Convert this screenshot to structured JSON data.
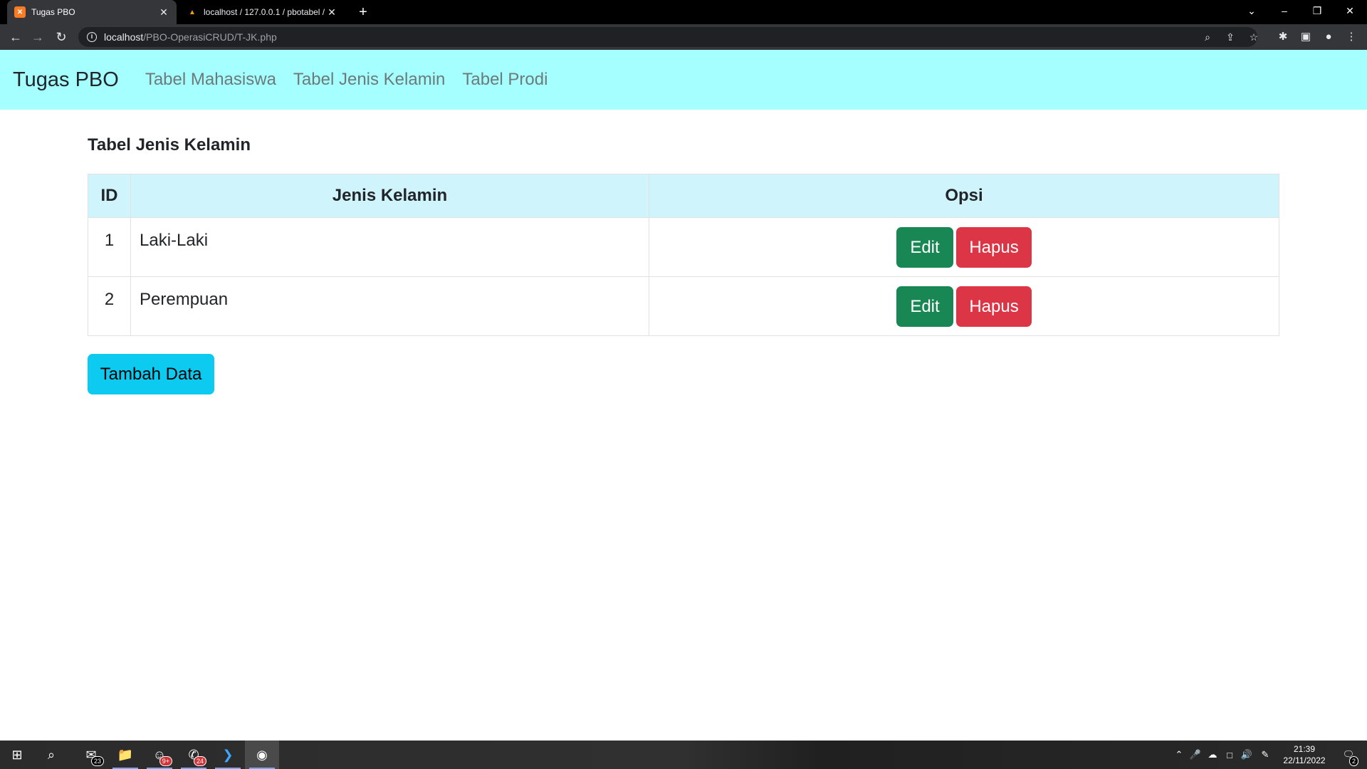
{
  "browser": {
    "tabs": [
      {
        "title": "Tugas PBO",
        "active": true
      },
      {
        "title": "localhost / 127.0.0.1 / pbotabel /",
        "active": false
      }
    ],
    "url_host": "localhost",
    "url_path": "/PBO-OperasiCRUD/T-JK.php"
  },
  "navbar": {
    "brand": "Tugas PBO",
    "links": [
      "Tabel Mahasiswa",
      "Tabel Jenis Kelamin",
      "Tabel Prodi"
    ]
  },
  "main": {
    "heading": "Tabel Jenis Kelamin",
    "columns": [
      "ID",
      "Jenis Kelamin",
      "Opsi"
    ],
    "rows": [
      {
        "id": "1",
        "jenis_kelamin": "Laki-Laki",
        "edit": "Edit",
        "hapus": "Hapus"
      },
      {
        "id": "2",
        "jenis_kelamin": "Perempuan",
        "edit": "Edit",
        "hapus": "Hapus"
      }
    ],
    "add_button": "Tambah Data"
  },
  "taskbar": {
    "mail_badge": "23",
    "discord_badge": "9+",
    "whatsapp_badge": "24",
    "time": "21:39",
    "date": "22/11/2022",
    "notifications_badge": "2"
  },
  "colors": {
    "navbar_bg": "#a6ffff",
    "table_header_bg": "#cff4fc",
    "edit_button": "#198754",
    "hapus_button": "#dc3545",
    "tambah_button": "#0dcaf0"
  }
}
